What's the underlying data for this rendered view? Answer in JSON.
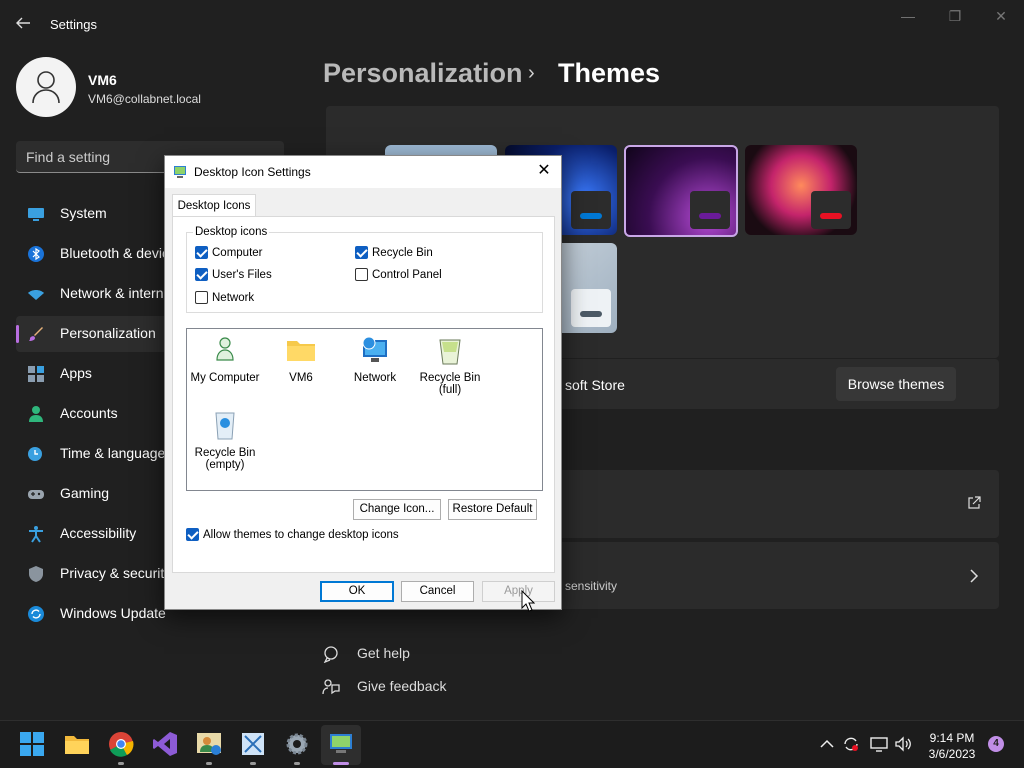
{
  "window": {
    "title": "Settings",
    "back_icon": "arrow-left-icon",
    "minimize_glyph": "—",
    "maximize_glyph": "❐",
    "close_glyph": "✕"
  },
  "profile": {
    "name": "VM6",
    "email": "VM6@collabnet.local"
  },
  "search": {
    "placeholder": "Find a setting"
  },
  "nav": [
    {
      "label": "System",
      "icon": "monitor-icon"
    },
    {
      "label": "Bluetooth & devices",
      "icon": "bluetooth-icon"
    },
    {
      "label": "Network & internet",
      "icon": "wifi-icon"
    },
    {
      "label": "Personalization",
      "icon": "brush-icon",
      "active": true
    },
    {
      "label": "Apps",
      "icon": "apps-icon"
    },
    {
      "label": "Accounts",
      "icon": "person-icon"
    },
    {
      "label": "Time & language",
      "icon": "clock-globe-icon"
    },
    {
      "label": "Gaming",
      "icon": "gamepad-icon"
    },
    {
      "label": "Accessibility",
      "icon": "accessibility-icon"
    },
    {
      "label": "Privacy & security",
      "icon": "shield-icon"
    },
    {
      "label": "Windows Update",
      "icon": "refresh-icon"
    }
  ],
  "breadcrumb": {
    "parent": "Personalization",
    "separator": "›",
    "current": "Themes"
  },
  "themes": {
    "store_text": "soft Store",
    "browse_label": "Browse themes",
    "accent_colors": [
      "#0078d4",
      "#6a1b9a",
      "#e81123",
      "#4c5a66"
    ]
  },
  "hidden_row": {
    "text": "sensitivity"
  },
  "help": {
    "get_help": "Get help",
    "give_feedback": "Give feedback"
  },
  "dialog": {
    "title": "Desktop Icon Settings",
    "close_glyph": "✕",
    "tab": "Desktop Icons",
    "group_label": "Desktop icons",
    "checkboxes": [
      {
        "label": "Computer",
        "checked": true
      },
      {
        "label": "Recycle Bin",
        "checked": true
      },
      {
        "label": "User's Files",
        "checked": true
      },
      {
        "label": "Control Panel",
        "checked": false
      },
      {
        "label": "Network",
        "checked": false
      }
    ],
    "icons": [
      {
        "line1": "My Computer",
        "line2": "",
        "icon": "computer-icon"
      },
      {
        "line1": "VM6",
        "line2": "",
        "icon": "folder-icon"
      },
      {
        "line1": "Network",
        "line2": "",
        "icon": "network-icon"
      },
      {
        "line1": "Recycle Bin",
        "line2": "(full)",
        "icon": "recycle-bin-full-icon"
      },
      {
        "line1": "Recycle Bin",
        "line2": "(empty)",
        "icon": "recycle-bin-empty-icon"
      }
    ],
    "change_icon": "Change Icon...",
    "restore_default": "Restore Default",
    "allow_themes": "Allow themes to change desktop icons",
    "allow_themes_checked": true,
    "ok": "OK",
    "cancel": "Cancel",
    "apply": "Apply"
  },
  "taskbar": {
    "apps": [
      "start-icon",
      "file-explorer-icon",
      "chrome-icon",
      "visual-studio-icon",
      "user-manager-icon",
      "snipping-tool-icon",
      "settings-icon",
      "remote-desktop-icon"
    ],
    "time": "9:14 PM",
    "date": "3/6/2023",
    "notification_count": "4",
    "tray": [
      "chevron-up-icon",
      "sync-icon",
      "display-icon",
      "speaker-icon"
    ]
  }
}
